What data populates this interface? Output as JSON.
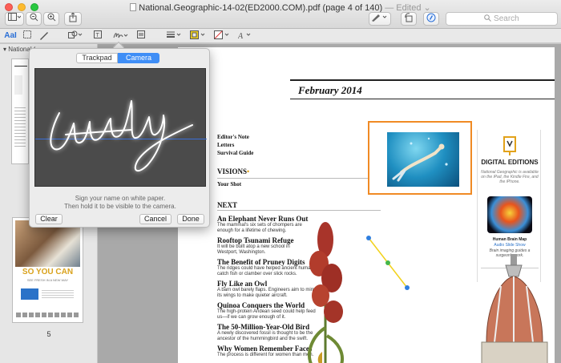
{
  "window": {
    "title": "National.Geographic-14-02(ED2000.COM).pdf (page 4 of 140)",
    "status": "— Edited",
    "status_arrow": "⌄"
  },
  "toolbar": {
    "search_placeholder": "Search",
    "icons": [
      "sidebar-icon",
      "zoom-out-icon",
      "zoom-in-icon",
      "share-icon",
      "pen-icon",
      "rotate-icon",
      "markup-icon"
    ]
  },
  "markup": {
    "text_style_label": "AaI"
  },
  "sidebar": {
    "header": "National Geographic 14-02(E",
    "page_number": "5",
    "thumb_headline": "SO YOU CAN",
    "thumb_sub": "SEE FRESH IN A NEW WAY"
  },
  "page": {
    "month": "February 2014",
    "front_items": [
      "Editor's Note",
      "Letters",
      "Survival Guide"
    ],
    "visions_label": "VISIONS",
    "visions_star": "•",
    "your_shot": "Your Shot",
    "next_label": "NEXT",
    "stories": [
      {
        "title": "An Elephant Never Runs Out",
        "body": "The mammal's six sets of chompers are enough for a lifetime of chewing."
      },
      {
        "title": "Rooftop Tsunami Refuge",
        "body": "It will be built atop a new school in Westport, Washington."
      },
      {
        "title": "The Benefit of Pruney Digits",
        "body": "The ridges could have helped ancient humans catch fish or clamber over slick rocks."
      },
      {
        "title": "Fly Like an Owl",
        "body": "A barn owl barely flaps. Engineers aim to mimic its wings to make quieter aircraft."
      },
      {
        "title": "Quinoa Conquers the World",
        "body": "The high-protein Andean seed could help feed us—if we can grow enough of it."
      },
      {
        "title": "The 50-Million-Year-Old Bird",
        "body": "A newly discovered fossil is thought to be the ancestor of the hummingbird and the swift."
      },
      {
        "title": "Why Women Remember Faces",
        "body": "The process is different for women than men."
      }
    ],
    "digital": {
      "title": "DIGITAL EDITIONS",
      "sub": "National Geographic is available on the iPad, the Kindle Fire, and the iPhone.",
      "caption_title": "Human Brain Map",
      "caption_link": "Audio Slide Show",
      "caption_body": "Brain imaging guides a surgeon's work."
    }
  },
  "signature": {
    "tab_trackpad": "Trackpad",
    "tab_camera": "Camera",
    "instruction_1": "Sign your name on white paper.",
    "instruction_2": "Then hold it to be visible to the camera.",
    "clear": "Clear",
    "cancel": "Cancel",
    "done": "Done"
  },
  "colors": {
    "accent": "#3f8ef6",
    "photo_border": "#f08a24",
    "annotation": "#f2d21c"
  }
}
